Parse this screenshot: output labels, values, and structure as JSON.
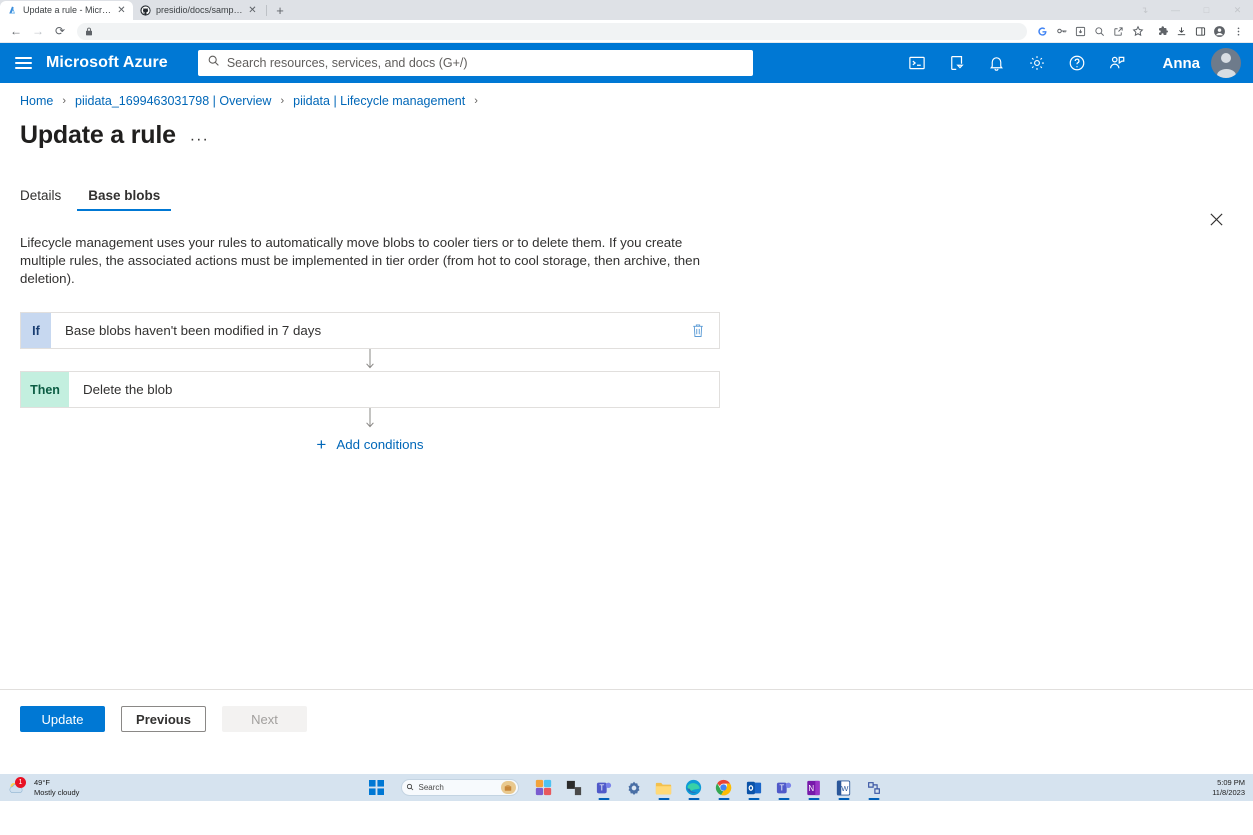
{
  "browser": {
    "tabs": [
      {
        "title": "Update a rule - Microsoft Azure",
        "favicon": "azure-icon",
        "active": true
      },
      {
        "title": "presidio/docs/samples/deploy:",
        "favicon": "github-icon",
        "active": false
      }
    ],
    "new_tab_label": "+",
    "nav": {
      "back": "←",
      "forward": "→",
      "reload": "⟳"
    },
    "omnibox": {
      "value": "",
      "placeholder": "",
      "lock_icon": "lock-icon"
    },
    "toolbar_icons": [
      "google-icon",
      "key-icon",
      "install-icon",
      "zoom-icon",
      "share-icon",
      "bookmark-star-icon",
      "extensions-icon",
      "downloads-icon",
      "sidepanel-icon",
      "profile-icon",
      "menu-kebab-icon"
    ],
    "window_controls": [
      "restore-icon",
      "minimize-icon",
      "maximize-icon",
      "close-icon"
    ]
  },
  "azure_header": {
    "menu_icon": "hamburger-icon",
    "brand": "Microsoft Azure",
    "search_placeholder": "Search resources, services, and docs (G+/)",
    "search_value": "",
    "icons": [
      "cloud-shell-icon",
      "directories-filter-icon",
      "notifications-bell-icon",
      "settings-gear-icon",
      "help-question-icon",
      "feedback-icon"
    ],
    "user_name": "Anna",
    "avatar": "user-avatar"
  },
  "breadcrumb": {
    "items": [
      "Home",
      "piidata_1699463031798 | Overview",
      "piidata | Lifecycle management"
    ],
    "separator": "›"
  },
  "page": {
    "title": "Update a rule",
    "ellipsis": "···",
    "close_icon": "close-icon"
  },
  "tabs": [
    {
      "label": "Details",
      "selected": false
    },
    {
      "label": "Base blobs",
      "selected": true
    }
  ],
  "description": "Lifecycle management uses your rules to automatically move blobs to cooler tiers or to delete them. If you create multiple rules, the associated actions must be implemented in tier order (from hot to cool storage, then archive, then deletion).",
  "rules": [
    {
      "badge": "If",
      "badge_type": "if",
      "text": "Base blobs haven't been modified in 7 days",
      "has_delete": true,
      "delete_icon": "trash-icon"
    },
    {
      "badge": "Then",
      "badge_type": "then",
      "text": "Delete the blob",
      "has_delete": false,
      "delete_icon": ""
    }
  ],
  "add_conditions": {
    "label": "Add conditions",
    "icon": "plus-icon"
  },
  "footer_buttons": [
    {
      "label": "Update",
      "style": "primary"
    },
    {
      "label": "Previous",
      "style": "secondary"
    },
    {
      "label": "Next",
      "style": "disabled"
    }
  ],
  "taskbar": {
    "weather": {
      "temp": "49°F",
      "condition": "Mostly cloudy",
      "badge": "1",
      "icon": "partly-cloudy-icon"
    },
    "start_icon": "windows-start-icon",
    "search_placeholder": "Search",
    "search_widget_icon": "briefcase-icon",
    "apps": [
      "photos-icon",
      "file-explorer-dark-icon",
      "teams-icon",
      "settings-gear-icon",
      "file-explorer-icon",
      "edge-icon",
      "chrome-icon",
      "outlook-icon",
      "teams-work-icon",
      "onenote-icon",
      "word-icon",
      "visio-icon"
    ],
    "clock": {
      "time": "5:09 PM",
      "date": "11/8/2023"
    }
  },
  "colors": {
    "azure_blue": "#0078d4",
    "link_blue": "#0067b8",
    "if_badge_bg": "#c7d8f0",
    "then_badge_bg": "#c3efdf",
    "taskbar_bg": "#d6e3ef"
  }
}
